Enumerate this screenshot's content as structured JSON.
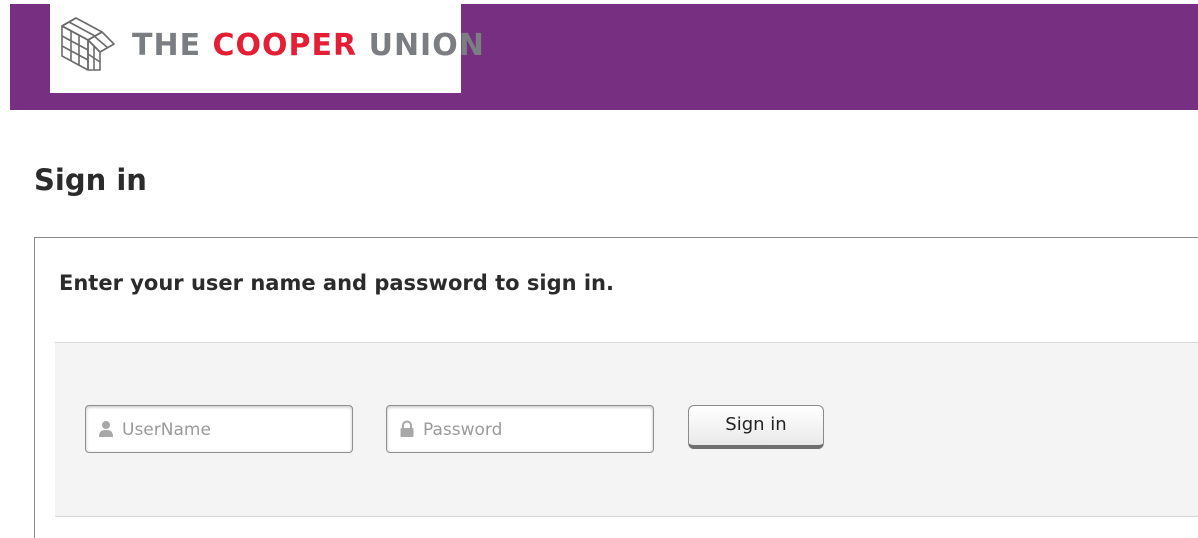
{
  "header": {
    "logo": {
      "word_the": "THE",
      "word_cooper": "COOPER",
      "word_union": "UNION"
    },
    "colors": {
      "bar": "#772f81",
      "logo_red": "#e41f35",
      "logo_gray": "#7a7d82"
    }
  },
  "page": {
    "title": "Sign in"
  },
  "panel": {
    "heading": "Enter your user name and password to sign in."
  },
  "form": {
    "username": {
      "icon": "user-icon",
      "placeholder": "UserName",
      "value": ""
    },
    "password": {
      "icon": "lock-icon",
      "placeholder": "Password",
      "value": ""
    },
    "submit_label": "Sign in"
  }
}
